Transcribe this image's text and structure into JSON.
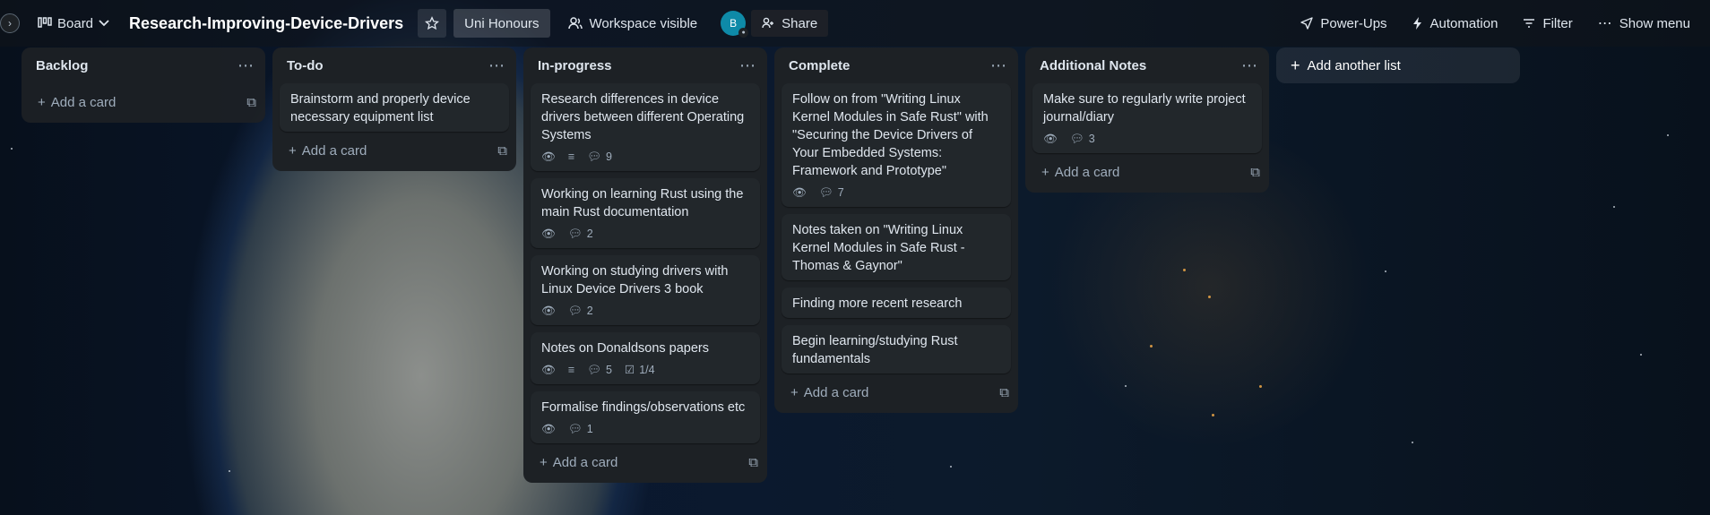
{
  "header": {
    "view_label": "Board",
    "board_title": "Research-Improving-Device-Drivers",
    "workspace_label": "Uni Honours",
    "visibility_label": "Workspace visible",
    "avatar_initial": "B",
    "share_label": "Share",
    "powerups_label": "Power-Ups",
    "automation_label": "Automation",
    "filter_label": "Filter",
    "show_menu_label": "Show menu"
  },
  "add_card_label": "Add a card",
  "add_list_label": "Add another list",
  "lists": [
    {
      "title": "Backlog",
      "cards": []
    },
    {
      "title": "To-do",
      "cards": [
        {
          "title": "Brainstorm and properly device necessary equipment list"
        }
      ]
    },
    {
      "title": "In-progress",
      "cards": [
        {
          "title": "Research differences in device drivers between different Operating Systems",
          "comments": "9",
          "has_description": true,
          "watching": true
        },
        {
          "title": "Working on learning Rust using the main Rust documentation",
          "comments": "2",
          "watching": true
        },
        {
          "title": "Working on studying drivers with Linux Device Drivers 3 book",
          "comments": "2",
          "watching": true
        },
        {
          "title": "Notes on Donaldsons papers",
          "comments": "5",
          "checklist": "1/4",
          "has_description": true,
          "watching": true
        },
        {
          "title": "Formalise findings/observations etc",
          "comments": "1",
          "watching": true
        }
      ]
    },
    {
      "title": "Complete",
      "cards": [
        {
          "title": "Follow on from \"Writing Linux Kernel Modules in Safe Rust\" with \"Securing the Device Drivers of Your Embedded Systems: Framework and Prototype\"",
          "comments": "7",
          "watching": true
        },
        {
          "title": "Notes taken on \"Writing Linux Kernel Modules in Safe Rust - Thomas & Gaynor\""
        },
        {
          "title": "Finding more recent research"
        },
        {
          "title": "Begin learning/studying Rust fundamentals"
        }
      ]
    },
    {
      "title": "Additional Notes",
      "cards": [
        {
          "title": "Make sure to regularly write project journal/diary",
          "comments": "3",
          "watching": true
        }
      ]
    }
  ],
  "colors": {
    "list_bg": "#1d2125",
    "card_bg": "#22272b",
    "avatar": "#0e8aa8"
  }
}
